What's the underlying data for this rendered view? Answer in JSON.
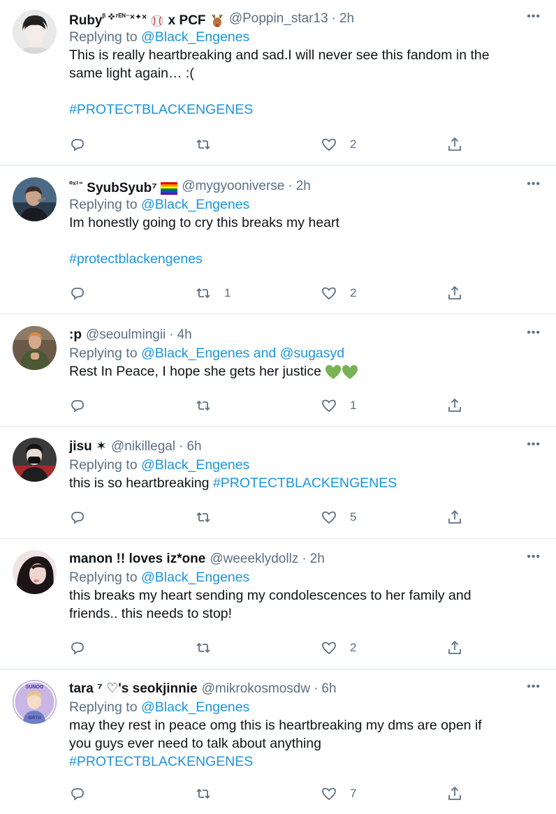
{
  "tweets": [
    {
      "name": "Ruby",
      "name_suffix": "ᵝ ✜⁷ᴱᴺ⁻×✦×",
      "name_tail": "x PCF",
      "handle": "@Poppin_star13",
      "time": "2h",
      "reply_label": "Replying to",
      "reply_to": "@Black_Engenes",
      "text_lines": [
        "This is really heartbreaking and sad.I will never see this fandom in the",
        "same light again… :("
      ],
      "hashtag": "#PROTECTBLACKENGENES",
      "reply_count": "",
      "retweet_count": "",
      "like_count": "2"
    },
    {
      "name_prefix": "⁰ˣ¹⁼",
      "name": "SyubSyub⁷",
      "handle": "@mygyooniverse",
      "time": "2h",
      "reply_label": "Replying to",
      "reply_to": "@Black_Engenes",
      "text_lines": [
        "Im honestly going to cry this breaks my heart"
      ],
      "hashtag": "#protectblackengenes",
      "reply_count": "",
      "retweet_count": "1",
      "like_count": "2"
    },
    {
      "name": ":p",
      "handle": "@seoulmingii",
      "time": "4h",
      "reply_label": "Replying to",
      "reply_to": "@Black_Engenes",
      "reply_and": "and",
      "reply_to_2": "@sugasyd",
      "text_lines": [
        "Rest In Peace, I hope she gets her justice "
      ],
      "emoji": "💚💚",
      "reply_count": "",
      "retweet_count": "",
      "like_count": "1"
    },
    {
      "name": "jisu ✶",
      "handle": "@nikillegal",
      "time": "6h",
      "reply_label": "Replying to",
      "reply_to": "@Black_Engenes",
      "text_lines": [
        "this is so heartbreaking "
      ],
      "inline_tag": "#PROTECTBLACKENGENES",
      "reply_count": "",
      "retweet_count": "",
      "like_count": "5"
    },
    {
      "name": "manon !! loves iz*one",
      "handle": "@weeeklydollz",
      "time": "2h",
      "reply_label": "Replying to",
      "reply_to": "@Black_Engenes",
      "text_lines": [
        "this breaks my heart sending my condolescences to her family and",
        "friends.. this needs to stop!"
      ],
      "reply_count": "",
      "retweet_count": "",
      "like_count": "2"
    },
    {
      "name": "tara ⁷ ♡'s seokjinnie",
      "handle": "@mikrokosmosdw",
      "time": "6h",
      "reply_label": "Replying to",
      "reply_to": "@Black_Engenes",
      "text_lines": [
        "may they rest in peace omg this is heartbreaking my dms are open if",
        "you guys ever need to talk about anything"
      ],
      "hashtag": "#PROTECTBLACKENGENES",
      "avatar_text": [
        "SUNOO",
        "BIRTH"
      ],
      "reply_count": "",
      "retweet_count": "",
      "like_count": "7"
    }
  ],
  "colors": {
    "link": "#1b95e0",
    "secondary": "#5b7083",
    "text": "#0f1419",
    "divider": "#e3e8ec",
    "heart_green": "#77b255"
  },
  "icons": {
    "reply": "reply-icon",
    "retweet": "retweet-icon",
    "like": "heart-icon",
    "share": "share-icon",
    "more": "more-icon"
  }
}
